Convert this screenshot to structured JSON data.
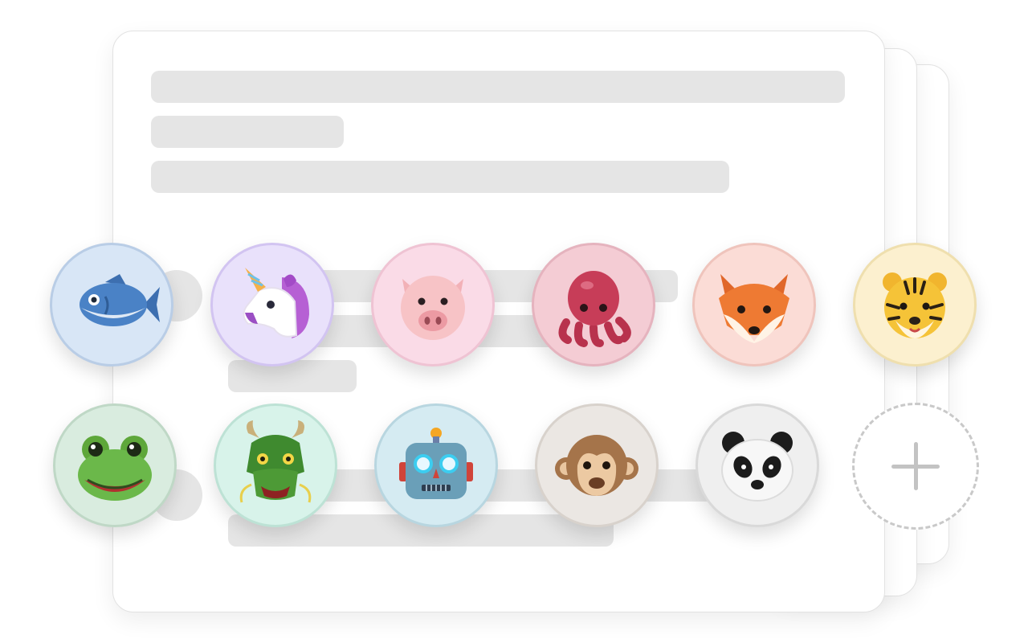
{
  "avatars": [
    {
      "name": "fish",
      "icon": "fish-icon",
      "bg": "#d8e6f6",
      "ring": "#b9cde6"
    },
    {
      "name": "unicorn",
      "icon": "unicorn-icon",
      "bg": "#e9e1fb",
      "ring": "#d2c4f1"
    },
    {
      "name": "pig",
      "icon": "pig-icon",
      "bg": "#fadbe7",
      "ring": "#efc3d3"
    },
    {
      "name": "octopus",
      "icon": "octopus-icon",
      "bg": "#f4ccd4",
      "ring": "#e5b3be"
    },
    {
      "name": "fox",
      "icon": "fox-icon",
      "bg": "#fbdcd6",
      "ring": "#efc4bc"
    },
    {
      "name": "tiger",
      "icon": "tiger-icon",
      "bg": "#fcf0cf",
      "ring": "#efdfae"
    },
    {
      "name": "frog",
      "icon": "frog-icon",
      "bg": "#d9ecdf",
      "ring": "#bfd8c6"
    },
    {
      "name": "dragon",
      "icon": "dragon-icon",
      "bg": "#d8f3ea",
      "ring": "#bde2d5"
    },
    {
      "name": "robot",
      "icon": "robot-icon",
      "bg": "#d5ebf2",
      "ring": "#b8d6e0"
    },
    {
      "name": "monkey",
      "icon": "monkey-icon",
      "bg": "#ebe7e3",
      "ring": "#d8d2cc"
    },
    {
      "name": "panda",
      "icon": "panda-icon",
      "bg": "#efefef",
      "ring": "#d9d9d9"
    }
  ],
  "add_button": {
    "icon": "plus-icon"
  }
}
